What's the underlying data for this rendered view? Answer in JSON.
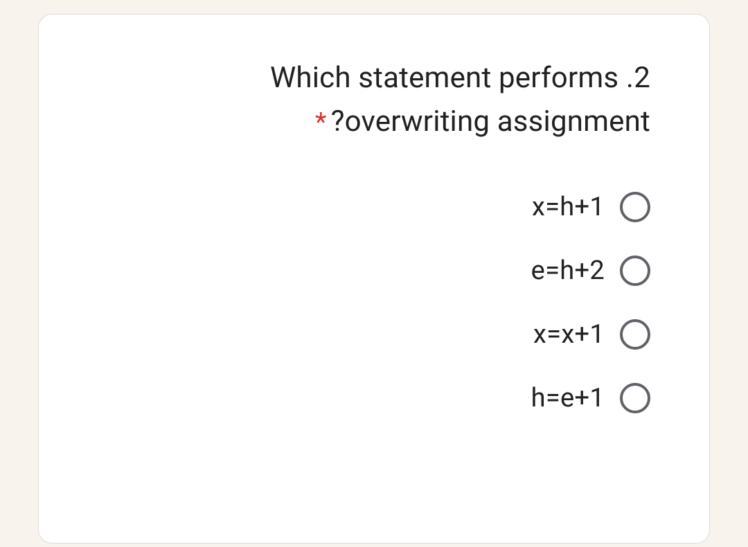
{
  "question": {
    "line1": "Which statement performs .2",
    "line2": "?overwriting assignment",
    "required_marker": "*"
  },
  "options": [
    {
      "label": "x=h+1"
    },
    {
      "label": "e=h+2"
    },
    {
      "label": "x=x+1"
    },
    {
      "label": "h=e+1"
    }
  ]
}
